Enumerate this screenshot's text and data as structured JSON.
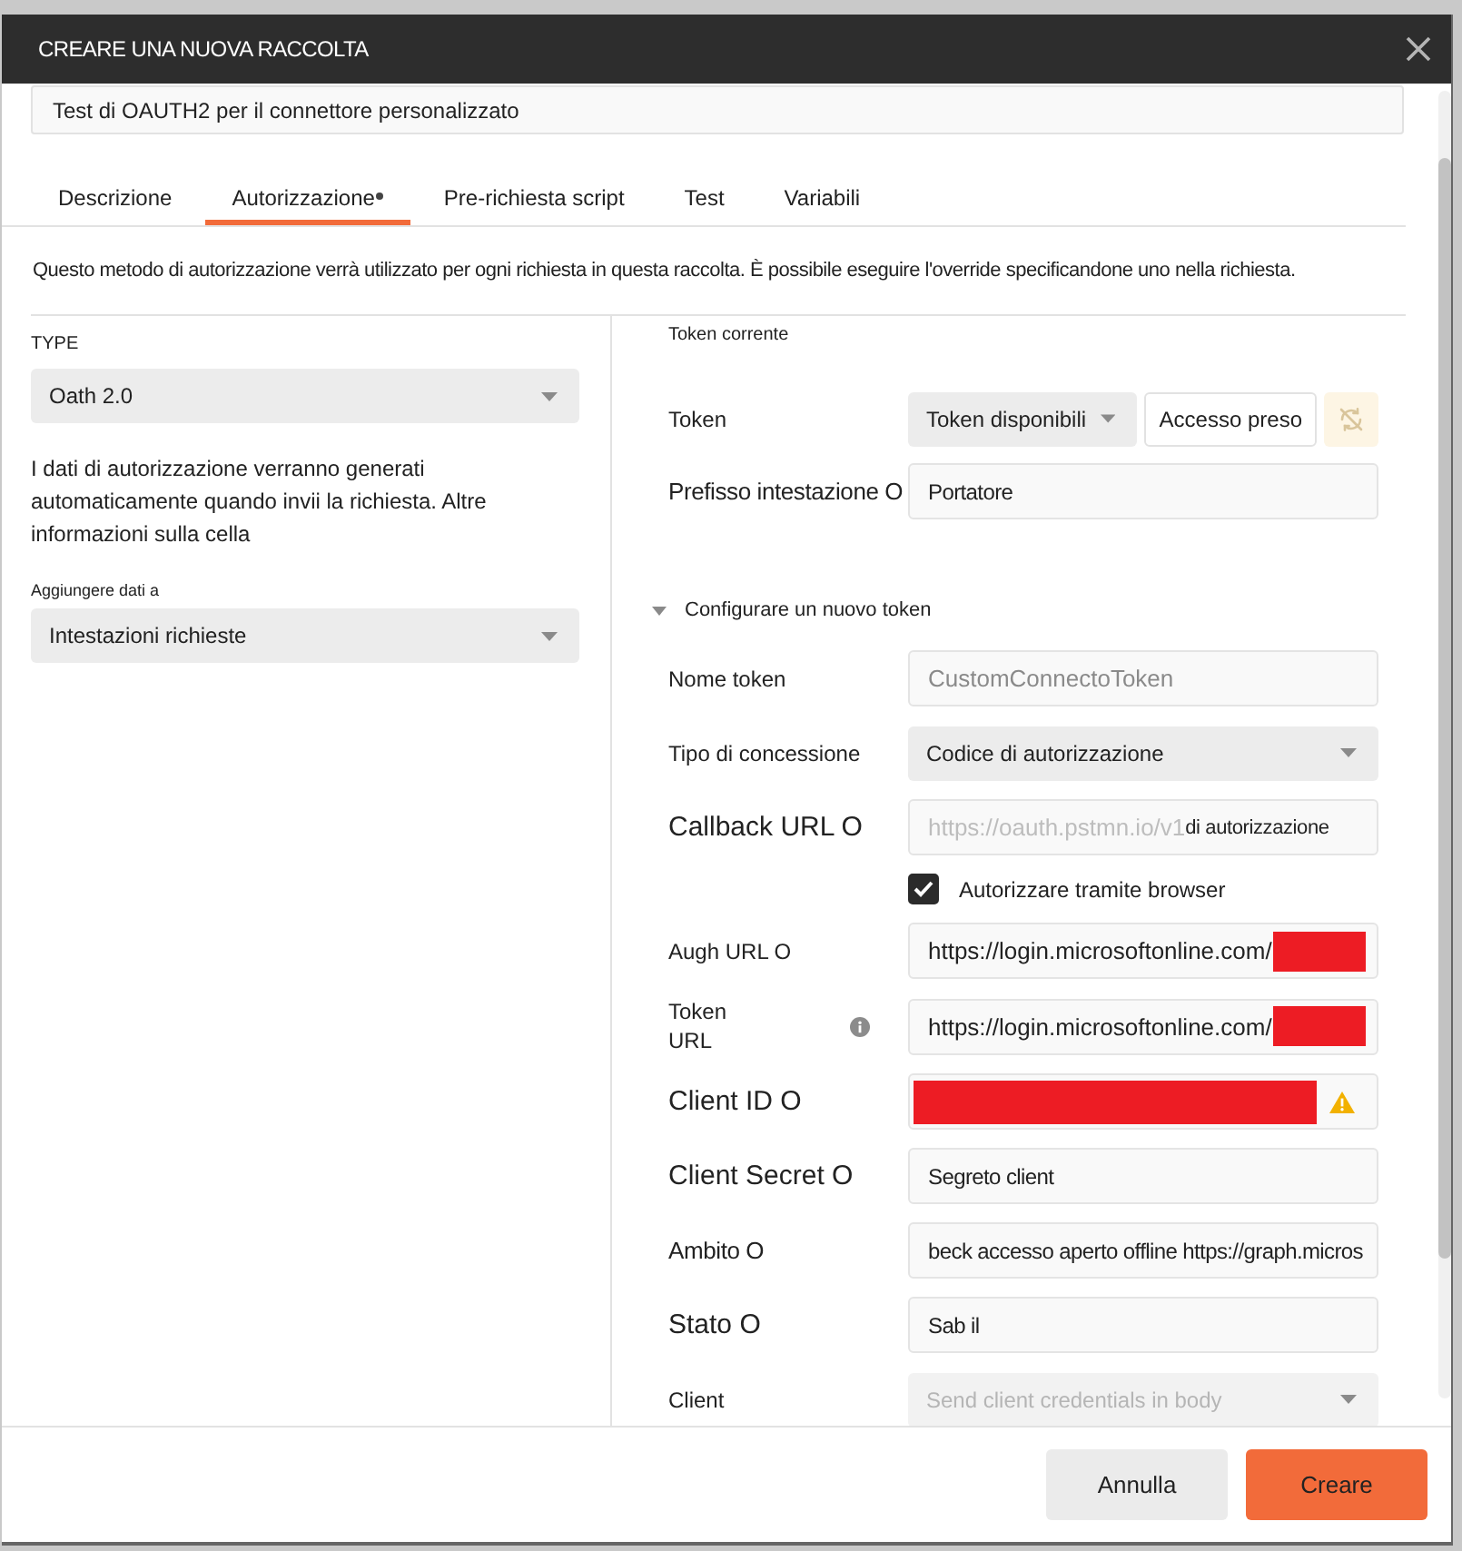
{
  "window": {
    "title": "CREARE UNA NUOVA RACCOLTA"
  },
  "collection_name": {
    "value": "Test di OAUTH2 per il connettore personalizzato"
  },
  "tabs": [
    {
      "label": "Descrizione",
      "selected": false,
      "modified": false
    },
    {
      "label": "Autorizzazione",
      "selected": true,
      "modified": true
    },
    {
      "label": "Pre-richiesta script",
      "selected": false,
      "modified": false
    },
    {
      "label": "Test",
      "selected": false,
      "modified": false
    },
    {
      "label": "Variabili",
      "selected": false,
      "modified": false
    }
  ],
  "description": "Questo metodo di autorizzazione verrà utilizzato per ogni richiesta in questa raccolta. È possibile eseguire l'override specificandone uno nella richiesta.",
  "auth_panel": {
    "type_label": "TYPE",
    "type_value": "Oath 2.0",
    "help_text": "I dati di autorizzazione verranno generati automaticamente quando invii la richiesta. Altre informazioni sulla cella",
    "add_to_label": "Aggiungere dati a",
    "add_to_value": "Intestazioni richieste"
  },
  "current_token": {
    "heading": "Token corrente",
    "rows": [
      {
        "kind": "token-select",
        "label": "Token",
        "select": "Token disponibili",
        "button": "Accesso preso"
      },
      {
        "kind": "input",
        "label": "Prefisso intestazione O",
        "value": "Portatore",
        "disabled": false
      }
    ]
  },
  "new_token": {
    "heading": "Configurare un nuovo token",
    "expanded": true,
    "rows": [
      {
        "kind": "input",
        "label": "Nome token",
        "placeholder": "CustomConnectoToken",
        "disabled": false
      },
      {
        "kind": "select",
        "label": "Tipo di concessione",
        "value": "Codice di autorizzazione",
        "disabled": false
      },
      {
        "kind": "input",
        "label": "Callback URL O",
        "value": "https://oauth.pstmn.io/v1",
        "suffix": "di autorizzazione",
        "disabled": true
      },
      {
        "kind": "checkbox",
        "label": "Autorizzare tramite browser",
        "checked": true
      },
      {
        "kind": "input",
        "label": "Augh URL O",
        "value": "https://login.microsoftonline.com/",
        "redacted": true,
        "disabled": false
      },
      {
        "kind": "input",
        "label": "Token URL",
        "value": "https://login.microsoftonline.com/",
        "redacted": true,
        "info": true,
        "disabled": false
      },
      {
        "kind": "input",
        "label": "Client ID O",
        "redacted": true,
        "warning": true,
        "disabled": false
      },
      {
        "kind": "input",
        "label": "Client Secret O",
        "value": "Segreto client",
        "disabled": false
      },
      {
        "kind": "input",
        "label": "Ambito O",
        "value": "beck accesso aperto offline https://graph.micros",
        "disabled": false
      },
      {
        "kind": "input",
        "label": "Stato O",
        "value": "Sab il",
        "disabled": false
      },
      {
        "kind": "select",
        "label": "Client",
        "value": "Send client credentials in body",
        "disabled": true
      }
    ]
  },
  "buttons": [
    {
      "label": "Annulla",
      "kind": "secondary"
    },
    {
      "label": "Creare",
      "kind": "primary"
    }
  ]
}
